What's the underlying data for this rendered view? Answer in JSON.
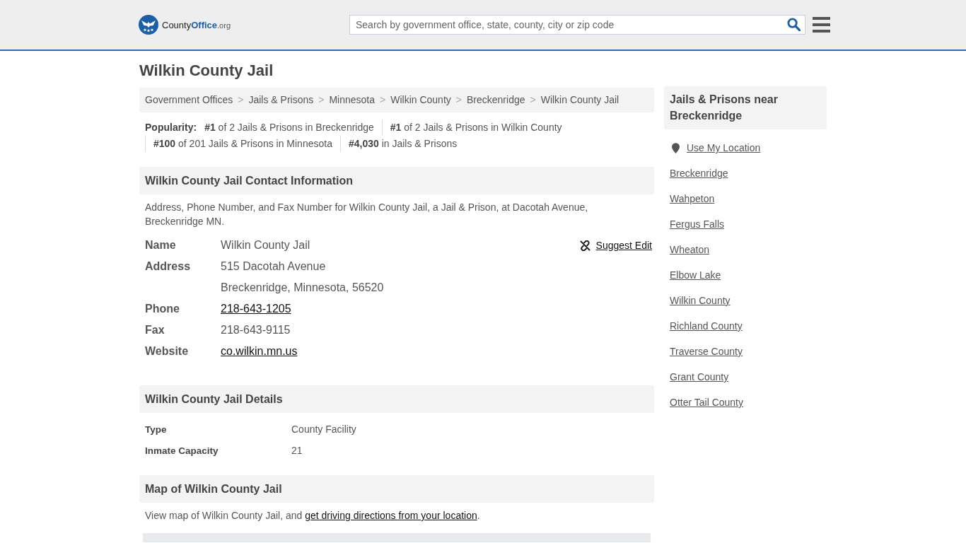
{
  "header": {
    "logo": {
      "parts": [
        "County",
        "Office",
        ".org"
      ]
    },
    "search": {
      "placeholder": "Search by government office, state, county, city or zip code"
    }
  },
  "page_title": "Wilkin County Jail",
  "breadcrumb": {
    "separator": ">",
    "items": [
      "Government Offices",
      "Jails & Prisons",
      "Minnesota",
      "Wilkin County",
      "Breckenridge",
      "Wilkin County Jail"
    ]
  },
  "popularity": {
    "label": "Popularity:",
    "items": [
      "**#1** of 2 Jails & Prisons in Breckenridge",
      "**#1** of 2 Jails & Prisons in Wilkin County",
      "**#100** of 201 Jails & Prisons in Minnesota",
      "**#4,030** in Jails & Prisons"
    ]
  },
  "contact": {
    "title": "Wilkin County Jail Contact Information",
    "description": "Address, Phone Number, and Fax Number for Wilkin County Jail, a Jail & Prison, at Dacotah Avenue, Breckenridge MN.",
    "suggest_edit": "Suggest Edit",
    "rows": [
      {
        "label": "Name",
        "value": "Wilkin County Jail",
        "kind": "text"
      },
      {
        "label": "Address",
        "value": "515 Dacotah Avenue",
        "kind": "text"
      },
      {
        "value": "Breckenridge, Minnesota, 56520",
        "kind": "text"
      },
      {
        "label": "Phone",
        "value": "218-643-1205",
        "kind": "link"
      },
      {
        "label": "Fax",
        "value": "218-643-9115",
        "kind": "text"
      },
      {
        "label": "Website",
        "value": "co.wilkin.mn.us",
        "kind": "link"
      }
    ]
  },
  "details": {
    "title": "Wilkin County Jail Details",
    "rows": [
      {
        "label": "Type",
        "value": "County Facility"
      },
      {
        "label": "Inmate Capacity",
        "value": "21"
      }
    ]
  },
  "map_section": {
    "title": "Map of Wilkin County Jail",
    "text_before": "View map of Wilkin County Jail, and ",
    "link": "get driving directions from your location",
    "text_after": "."
  },
  "sidebar": {
    "title": "Jails & Prisons near Breckenridge",
    "use_location": "Use My Location",
    "links": [
      "Breckenridge",
      "Wahpeton",
      "Fergus Falls",
      "Wheaton",
      "Elbow Lake",
      "Wilkin County",
      "Richland County",
      "Traverse County",
      "Grant County",
      "Otter Tail County"
    ]
  }
}
